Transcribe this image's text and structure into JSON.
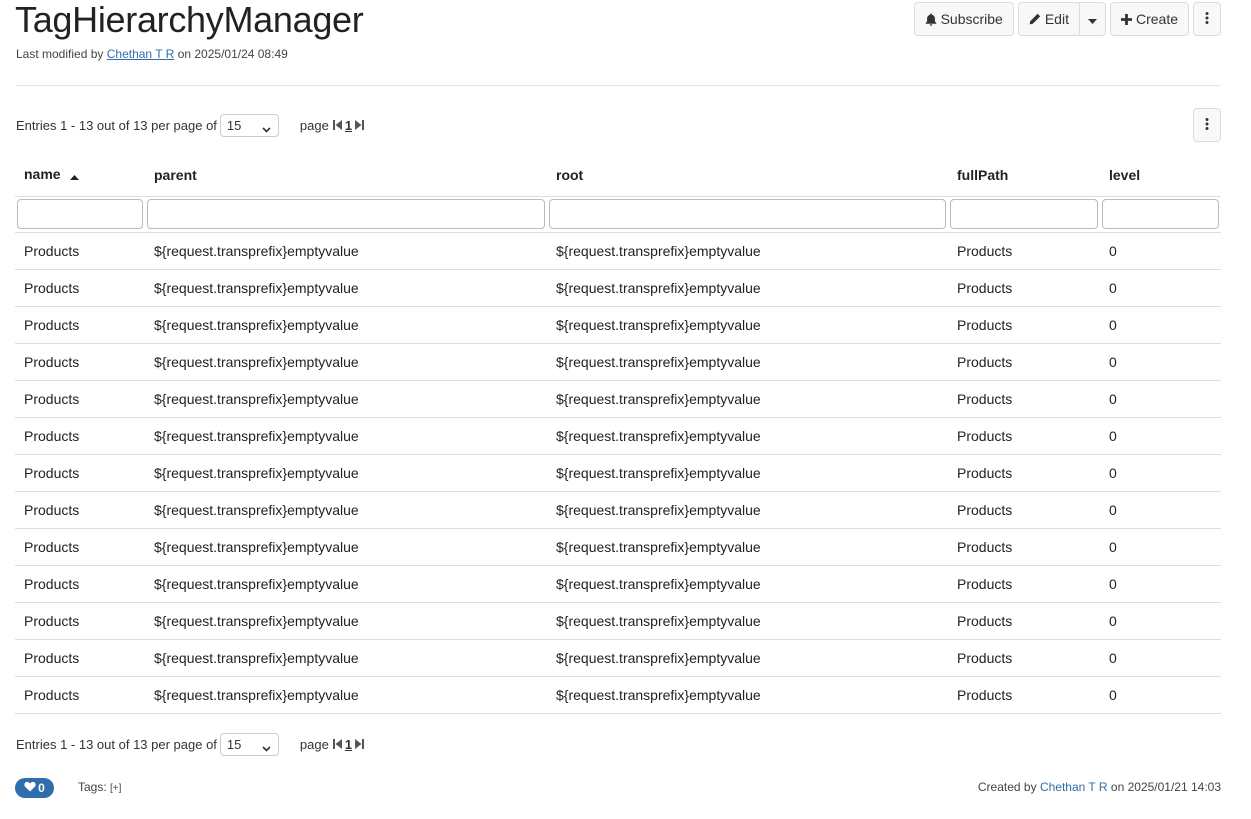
{
  "header": {
    "title": "TagHierarchyManager",
    "modified_prefix": "Last modified by",
    "modified_user": "Chethan T R",
    "modified_suffix": "on 2025/01/24 08:49"
  },
  "actions": {
    "subscribe": "Subscribe",
    "edit": "Edit",
    "create": "Create"
  },
  "pager": {
    "entries_text": "Entries 1 - 13 out of 13 per page of",
    "per_page": "15",
    "per_page_options": [
      "15"
    ],
    "page_label": "page",
    "current_page": "1"
  },
  "table": {
    "columns": [
      "name",
      "parent",
      "root",
      "fullPath",
      "level"
    ],
    "sorted_column": "name",
    "rows": [
      [
        "Products",
        "${request.transprefix}emptyvalue",
        "${request.transprefix}emptyvalue",
        "Products",
        "0"
      ],
      [
        "Products",
        "${request.transprefix}emptyvalue",
        "${request.transprefix}emptyvalue",
        "Products",
        "0"
      ],
      [
        "Products",
        "${request.transprefix}emptyvalue",
        "${request.transprefix}emptyvalue",
        "Products",
        "0"
      ],
      [
        "Products",
        "${request.transprefix}emptyvalue",
        "${request.transprefix}emptyvalue",
        "Products",
        "0"
      ],
      [
        "Products",
        "${request.transprefix}emptyvalue",
        "${request.transprefix}emptyvalue",
        "Products",
        "0"
      ],
      [
        "Products",
        "${request.transprefix}emptyvalue",
        "${request.transprefix}emptyvalue",
        "Products",
        "0"
      ],
      [
        "Products",
        "${request.transprefix}emptyvalue",
        "${request.transprefix}emptyvalue",
        "Products",
        "0"
      ],
      [
        "Products",
        "${request.transprefix}emptyvalue",
        "${request.transprefix}emptyvalue",
        "Products",
        "0"
      ],
      [
        "Products",
        "${request.transprefix}emptyvalue",
        "${request.transprefix}emptyvalue",
        "Products",
        "0"
      ],
      [
        "Products",
        "${request.transprefix}emptyvalue",
        "${request.transprefix}emptyvalue",
        "Products",
        "0"
      ],
      [
        "Products",
        "${request.transprefix}emptyvalue",
        "${request.transprefix}emptyvalue",
        "Products",
        "0"
      ],
      [
        "Products",
        "${request.transprefix}emptyvalue",
        "${request.transprefix}emptyvalue",
        "Products",
        "0"
      ],
      [
        "Products",
        "${request.transprefix}emptyvalue",
        "${request.transprefix}emptyvalue",
        "Products",
        "0"
      ]
    ]
  },
  "footer": {
    "like_count": "0",
    "tags_label": "Tags:",
    "tags_add": "[+]",
    "created_prefix": "Created by",
    "created_user": "Chethan T R",
    "created_suffix": "on 2025/01/21 14:03"
  },
  "colors": {
    "accent": "#2f6eaa",
    "border": "#dddddd"
  },
  "icons": [
    "bell-icon",
    "pencil-icon",
    "caret-down-icon",
    "plus-icon",
    "kebab-icon",
    "sort-asc-icon",
    "first-page-icon",
    "last-page-icon",
    "heart-icon"
  ]
}
